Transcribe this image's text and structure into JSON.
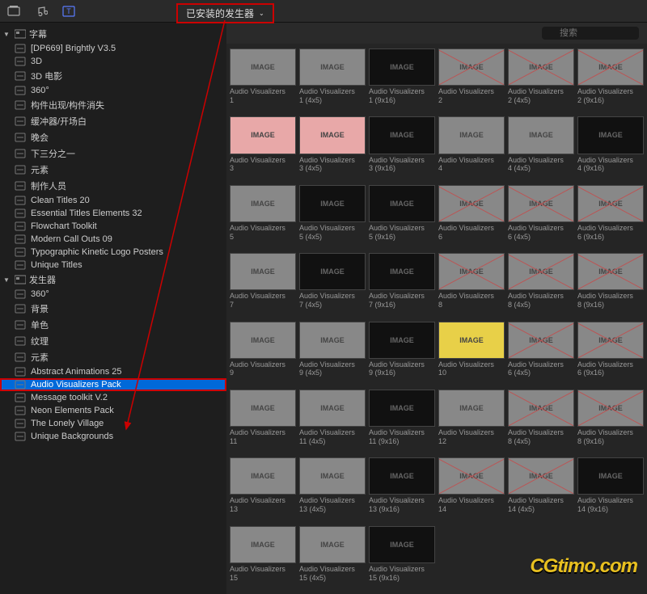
{
  "toolbar": {
    "dropdown_label": "已安装的发生器"
  },
  "search": {
    "placeholder": "搜索"
  },
  "sidebar": {
    "categories": [
      {
        "label": "字幕",
        "expanded": true,
        "items": [
          "[DP669] Brightly V3.5",
          "3D",
          "3D 电影",
          "360°",
          "构件出现/构件消失",
          "缓冲器/开场白",
          "晚会",
          "下三分之一",
          "元素",
          "制作人员",
          "Clean Titles 20",
          "Essential Titles Elements 32",
          "Flowchart Toolkit",
          "Modern Call Outs 09",
          "Typographic Kinetic Logo Posters",
          "Unique Titles"
        ]
      },
      {
        "label": "发生器",
        "expanded": true,
        "items": [
          "360°",
          "背景",
          "单色",
          "纹理",
          "元素",
          "Abstract Animations 25",
          "Audio Visualizers Pack",
          "Message toolkit V.2",
          "Neon Elements Pack",
          "The Lonely Village",
          "Unique Backgrounds"
        ],
        "selected_index": 6
      }
    ]
  },
  "grid": [
    {
      "l1": "Audio Visualizers",
      "l2": "1",
      "cls": ""
    },
    {
      "l1": "Audio Visualizers",
      "l2": "1 (4x5)",
      "cls": ""
    },
    {
      "l1": "Audio Visualizers",
      "l2": "1 (9x16)",
      "cls": "dark"
    },
    {
      "l1": "Audio Visualizers",
      "l2": "2",
      "cls": "cross"
    },
    {
      "l1": "Audio Visualizers",
      "l2": "2 (4x5)",
      "cls": "cross"
    },
    {
      "l1": "Audio Visualizers",
      "l2": "2 (9x16)",
      "cls": "cross"
    },
    {
      "l1": "Audio Visualizers",
      "l2": "3",
      "cls": "pink"
    },
    {
      "l1": "Audio Visualizers",
      "l2": "3 (4x5)",
      "cls": "pink"
    },
    {
      "l1": "Audio Visualizers",
      "l2": "3 (9x16)",
      "cls": "dark"
    },
    {
      "l1": "Audio Visualizers",
      "l2": "4",
      "cls": ""
    },
    {
      "l1": "Audio Visualizers",
      "l2": "4 (4x5)",
      "cls": ""
    },
    {
      "l1": "Audio Visualizers",
      "l2": "4 (9x16)",
      "cls": "dark"
    },
    {
      "l1": "Audio Visualizers",
      "l2": "5",
      "cls": ""
    },
    {
      "l1": "Audio Visualizers",
      "l2": "5 (4x5)",
      "cls": "dark"
    },
    {
      "l1": "Audio Visualizers",
      "l2": "5 (9x16)",
      "cls": "dark"
    },
    {
      "l1": "Audio Visualizers",
      "l2": "6",
      "cls": "cross"
    },
    {
      "l1": "Audio Visualizers",
      "l2": "6 (4x5)",
      "cls": "cross"
    },
    {
      "l1": "Audio Visualizers",
      "l2": "6 (9x16)",
      "cls": "cross"
    },
    {
      "l1": "Audio Visualizers",
      "l2": "7",
      "cls": ""
    },
    {
      "l1": "Audio Visualizers",
      "l2": "7 (4x5)",
      "cls": "dark"
    },
    {
      "l1": "Audio Visualizers",
      "l2": "7 (9x16)",
      "cls": "dark"
    },
    {
      "l1": "Audio Visualizers",
      "l2": "8",
      "cls": "cross"
    },
    {
      "l1": "Audio Visualizers",
      "l2": "8 (4x5)",
      "cls": "cross"
    },
    {
      "l1": "Audio Visualizers",
      "l2": "8 (9x16)",
      "cls": "cross"
    },
    {
      "l1": "Audio Visualizers",
      "l2": "9",
      "cls": ""
    },
    {
      "l1": "Audio Visualizers",
      "l2": "9 (4x5)",
      "cls": ""
    },
    {
      "l1": "Audio Visualizers",
      "l2": "9 (9x16)",
      "cls": "dark"
    },
    {
      "l1": "Audio Visualizers",
      "l2": "10",
      "cls": "yellow"
    },
    {
      "l1": "Audio Visualizers",
      "l2": "6 (4x5)",
      "cls": "cross"
    },
    {
      "l1": "Audio Visualizers",
      "l2": "6 (9x16)",
      "cls": "cross"
    },
    {
      "l1": "Audio Visualizers",
      "l2": "11",
      "cls": ""
    },
    {
      "l1": "Audio Visualizers",
      "l2": "11 (4x5)",
      "cls": ""
    },
    {
      "l1": "Audio Visualizers",
      "l2": "11 (9x16)",
      "cls": "dark"
    },
    {
      "l1": "Audio Visualizers",
      "l2": "12",
      "cls": ""
    },
    {
      "l1": "Audio Visualizers",
      "l2": "8 (4x5)",
      "cls": "cross"
    },
    {
      "l1": "Audio Visualizers",
      "l2": "8 (9x16)",
      "cls": "cross"
    },
    {
      "l1": "Audio Visualizers",
      "l2": "13",
      "cls": ""
    },
    {
      "l1": "Audio Visualizers",
      "l2": "13 (4x5)",
      "cls": ""
    },
    {
      "l1": "Audio Visualizers",
      "l2": "13 (9x16)",
      "cls": "dark"
    },
    {
      "l1": "Audio Visualizers",
      "l2": "14",
      "cls": "cross"
    },
    {
      "l1": "Audio Visualizers",
      "l2": "14 (4x5)",
      "cls": "cross"
    },
    {
      "l1": "Audio Visualizers",
      "l2": "14 (9x16)",
      "cls": "dark"
    },
    {
      "l1": "Audio Visualizers",
      "l2": "15",
      "cls": ""
    },
    {
      "l1": "Audio Visualizers",
      "l2": "15 (4x5)",
      "cls": ""
    },
    {
      "l1": "Audio Visualizers",
      "l2": "15 (9x16)",
      "cls": "dark"
    }
  ],
  "watermark": "CGtimo.com"
}
